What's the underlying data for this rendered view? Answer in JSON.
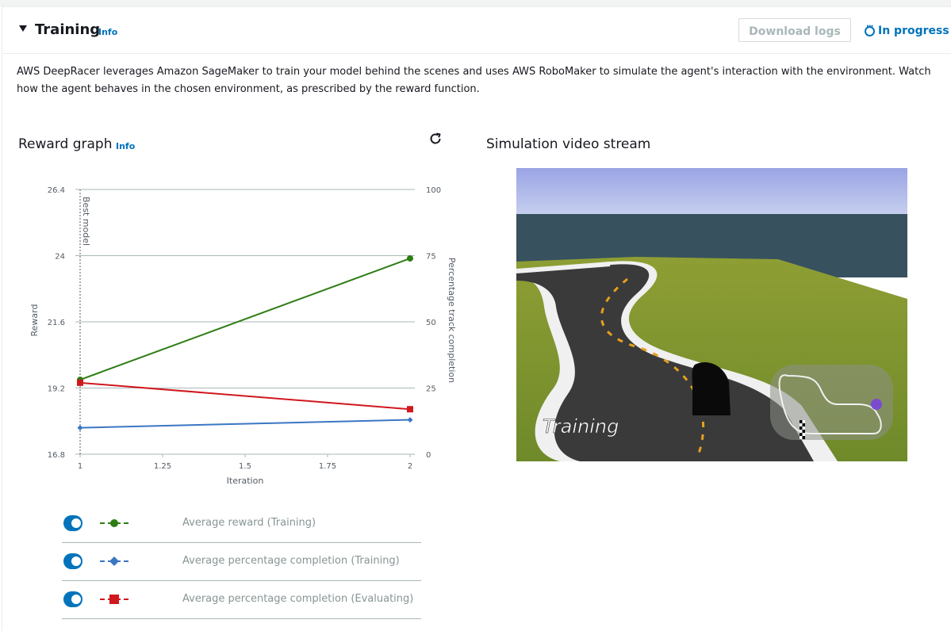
{
  "header": {
    "title": "Training",
    "info_label": "Info",
    "download_label": "Download logs",
    "status_label": "In progress"
  },
  "description": "AWS DeepRacer leverages Amazon SageMaker to train your model behind the scenes and uses AWS RoboMaker to simulate the agent's interaction with the environment. Watch how the agent behaves in the chosen environment, as prescribed by the reward function.",
  "reward_graph": {
    "title": "Reward graph",
    "info_label": "Info"
  },
  "video": {
    "title": "Simulation video stream",
    "overlay_text": "Training"
  },
  "colors": {
    "accent": "#0073bb",
    "reward_training": "#2e7d14",
    "completion_training": "#3b76c4",
    "completion_evaluating": "#d0181f"
  },
  "chart_data": {
    "type": "line",
    "xlabel": "Iteration",
    "ylabel": "Reward",
    "y2label": "Percentage track completion",
    "x_ticks": [
      "1",
      "1.25",
      "1.5",
      "1.75",
      "2"
    ],
    "y_ticks": [
      "16.8",
      "19.2",
      "21.6",
      "24",
      "26.4"
    ],
    "y2_ticks": [
      "0",
      "25",
      "50",
      "75",
      "100"
    ],
    "xlim": [
      1,
      2
    ],
    "ylim": [
      16.8,
      26.4
    ],
    "y2lim": [
      0,
      100
    ],
    "best_model_label": "Best model",
    "best_model_x": 1,
    "grid": true,
    "series": [
      {
        "name": "Average reward (Training)",
        "axis": "left",
        "marker": "circle",
        "color": "#2e7d14",
        "x": [
          1,
          2
        ],
        "values": [
          19.5,
          23.9
        ]
      },
      {
        "name": "Average percentage completion (Training)",
        "axis": "right",
        "marker": "diamond",
        "color": "#3b76c4",
        "x": [
          1,
          2
        ],
        "values": [
          10,
          13
        ]
      },
      {
        "name": "Average percentage completion (Evaluating)",
        "axis": "right",
        "marker": "square",
        "color": "#d0181f",
        "x": [
          1,
          2
        ],
        "values": [
          27,
          17
        ]
      }
    ]
  },
  "legend": [
    {
      "label": "Average reward (Training)",
      "marker": "circle",
      "color": "#2e7d14",
      "enabled": true
    },
    {
      "label": "Average percentage completion (Training)",
      "marker": "diamond",
      "color": "#3b76c4",
      "enabled": true
    },
    {
      "label": "Average percentage completion (Evaluating)",
      "marker": "square",
      "color": "#d0181f",
      "enabled": true
    }
  ]
}
